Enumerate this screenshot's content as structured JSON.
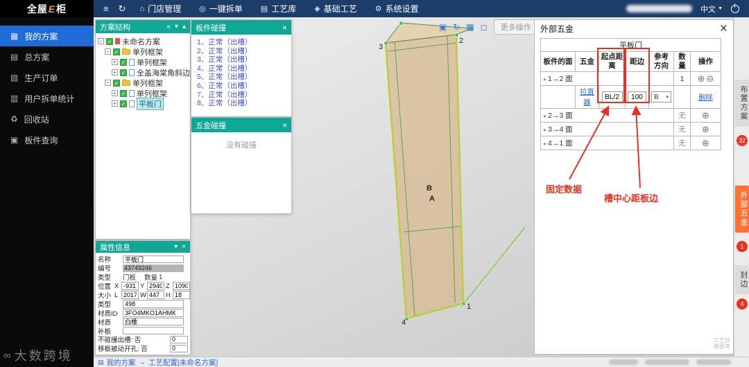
{
  "icons": {
    "menu": "≡",
    "refresh": "↻",
    "caret_down": "▼",
    "close": "×",
    "plus_circle": "⊕",
    "minus_circle": "⊖",
    "collapse": "«",
    "chev_down": "▾",
    "chev_up": "▴",
    "expand_open": "−",
    "expand_closed": "+",
    "check": "✓",
    "tri_right": "▸",
    "crumb_icon": "▤",
    "vp1": "▣",
    "vp2": "↻",
    "vp3": "▦",
    "vp4": "◻",
    "wm_logo": "∞"
  },
  "app": {
    "logo_pre": "全屋",
    "logo_e": "E",
    "logo_post": "柜",
    "nav": [
      {
        "icon": "⌂",
        "label": "门店管理"
      },
      {
        "icon": "◎",
        "label": "一键拆单"
      },
      {
        "icon": "▤",
        "label": "工艺库"
      },
      {
        "icon": "◈",
        "label": "基础工艺"
      },
      {
        "icon": "⚙",
        "label": "系统设置"
      }
    ],
    "lang": "中文"
  },
  "sidebar": {
    "items": [
      {
        "icon": "▦",
        "label": "我的方案"
      },
      {
        "icon": "▤",
        "label": "总方案"
      },
      {
        "icon": "▧",
        "label": "生产订单"
      },
      {
        "icon": "▥",
        "label": "用户拆单统计"
      },
      {
        "icon": "♻",
        "label": "回收站"
      },
      {
        "icon": "▣",
        "label": "板件查询"
      }
    ],
    "watermark": "大数跨境"
  },
  "structure_panel": {
    "title": "方案结构",
    "tree": [
      {
        "label": "未命名方案"
      },
      {
        "label": "单列框架"
      },
      {
        "label": "单列框架"
      },
      {
        "label": "全盖海棠角斜边门"
      },
      {
        "label": "单列框架"
      },
      {
        "label": "单列框架"
      },
      {
        "label": "平板门"
      }
    ]
  },
  "board_collision": {
    "title": "板件碰撞",
    "items": [
      "1、正常（出槽）",
      "2、正常（出槽）",
      "3、正常（出槽）",
      "4、正常（出槽）",
      "5、正常（出槽）",
      "6、正常（出槽）",
      "7、正常（出槽）",
      "8、正常（出槽）"
    ]
  },
  "hardware_collision": {
    "title": "五金碰撞",
    "empty_text": "没有碰撞"
  },
  "properties": {
    "title": "属性信息",
    "name_label": "名称",
    "name": "平板门",
    "code_label": "编号",
    "code": "43749246",
    "type_label": "类型",
    "type_value": "门板",
    "qty_label": "数量",
    "qty_value": "1",
    "pos_label": "位置",
    "x_label": "X",
    "x": "-931.0",
    "y_label": "Y",
    "y": "2940.",
    "z_label": "Z",
    "z": "1090",
    "size_label": "大小",
    "l_label": "L",
    "l": "2017",
    "w_label": "W",
    "w": "447",
    "h_label": "H",
    "h": "18",
    "type2_label": "类型",
    "type2": "498",
    "matid_label": "材质ID",
    "matid": "3FO4MKO1AHMK",
    "mat_label": "材质",
    "mat": "白橡",
    "patch_label": "补板",
    "patch": "",
    "noslot_label": "不碰撞出槽: 否",
    "noslot": "0",
    "movehole_label": "移板被动开孔: 否",
    "movehole": "0"
  },
  "viewport": {
    "more_label": "更多操作",
    "markers": {
      "m1": "1",
      "m2": "2",
      "m3": "3",
      "m4": "4"
    },
    "labels": {
      "b": "B",
      "a": "A"
    }
  },
  "hardware_panel": {
    "title": "外部五金",
    "table_title": "平板门",
    "columns": [
      "板件的面",
      "五金",
      "起点距离",
      "距边",
      "参考方向",
      "数量",
      "操作"
    ],
    "groups": [
      {
        "face": "1→2 面",
        "qty": "1"
      },
      {
        "face": "2→3 面",
        "qty": "无"
      },
      {
        "face": "3→4 面",
        "qty": "无"
      },
      {
        "face": "4→1 面",
        "qty": "无"
      }
    ],
    "detail": {
      "hardware": "拉直器",
      "start": "BL/2",
      "edge": "100",
      "dir": "B",
      "op": "删除"
    },
    "annotations": {
      "fixed": "固定数据",
      "groove": "槽中心距板边"
    },
    "wm1": "工艺妖",
    "wm2": "数据等"
  },
  "right_tabs": [
    {
      "label": "布置方案",
      "badge": "32"
    },
    {
      "label": "外部五金",
      "badge": "1"
    },
    {
      "label": "封边",
      "badge": "4"
    }
  ],
  "statusbar": {
    "crumb1": "我的方案",
    "arrow": "→",
    "crumb2": "工艺配置[未命名方案]"
  }
}
